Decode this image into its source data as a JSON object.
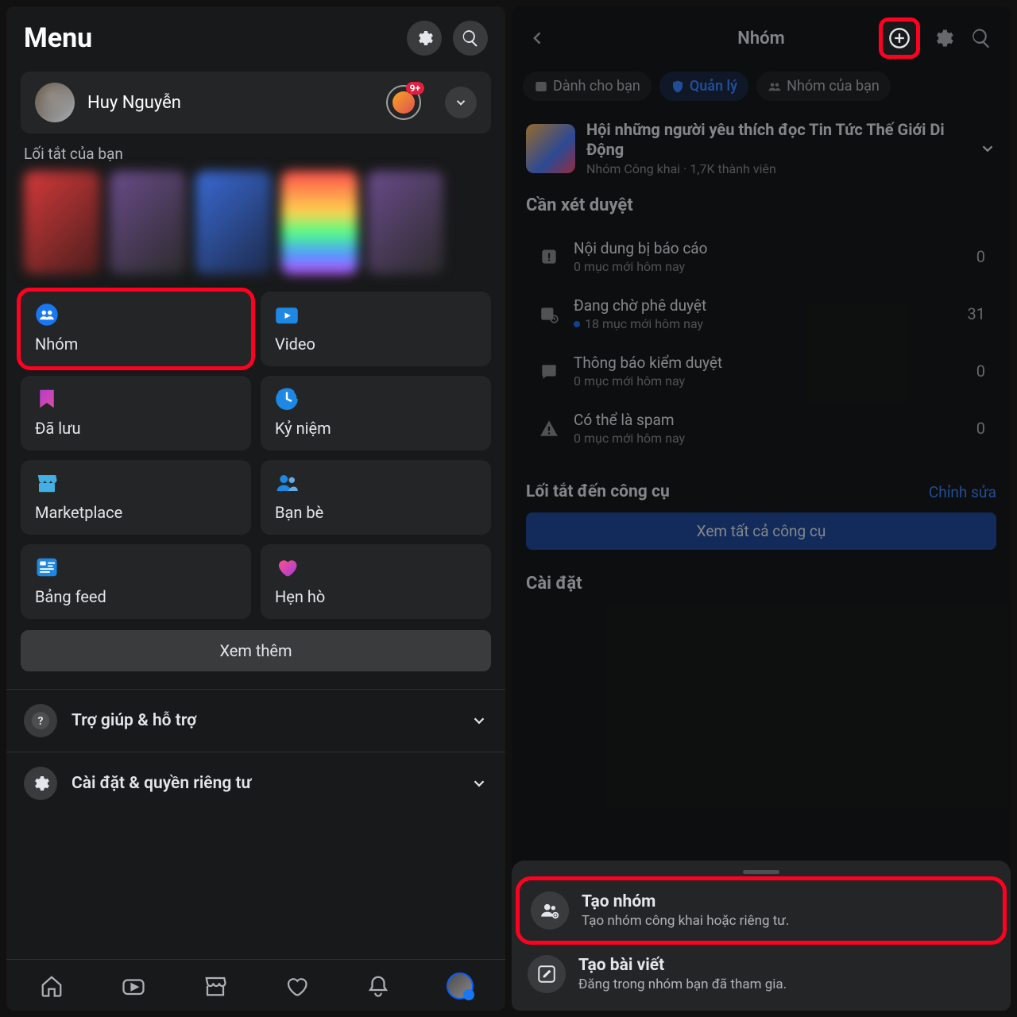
{
  "left": {
    "title": "Menu",
    "profile_name": "Huy Nguyễn",
    "badge": "9+",
    "shortcuts_label": "Lối tắt của bạn",
    "menu": {
      "groups": "Nhóm",
      "video": "Video",
      "saved": "Đã lưu",
      "memories": "Kỷ niệm",
      "marketplace": "Marketplace",
      "friends": "Bạn bè",
      "feeds": "Bảng feed",
      "dating": "Hẹn hò"
    },
    "see_more": "Xem thêm",
    "help": "Trợ giúp & hỗ trợ",
    "settings": "Cài đặt & quyền riêng tư"
  },
  "right": {
    "title": "Nhóm",
    "chips": {
      "for_you": "Dành cho bạn",
      "manage": "Quản lý",
      "your_groups": "Nhóm của bạn"
    },
    "group": {
      "name": "Hội những người yêu thích đọc Tin Tức Thế Giới Di Động",
      "meta": "Nhóm Công khai · 1,7K thành viên"
    },
    "review_header": "Cần xét duyệt",
    "review": [
      {
        "title": "Nội dung bị báo cáo",
        "sub": "0 mục mới hôm nay",
        "count": "0",
        "blue": false
      },
      {
        "title": "Đang chờ phê duyệt",
        "sub": "18 mục mới hôm nay",
        "count": "31",
        "blue": true
      },
      {
        "title": "Thông báo kiểm duyệt",
        "sub": "0 mục mới hôm nay",
        "count": "0",
        "blue": false
      },
      {
        "title": "Có thể là spam",
        "sub": "0 mục mới hôm nay",
        "count": "0",
        "blue": false
      }
    ],
    "tools_label": "Lối tắt đến công cụ",
    "edit_label": "Chỉnh sửa",
    "view_all": "Xem tất cả công cụ",
    "settings_label": "Cài đặt",
    "sheet": {
      "create_group_title": "Tạo nhóm",
      "create_group_sub": "Tạo nhóm công khai hoặc riêng tư.",
      "create_post_title": "Tạo bài viết",
      "create_post_sub": "Đăng trong nhóm bạn đã tham gia."
    }
  }
}
